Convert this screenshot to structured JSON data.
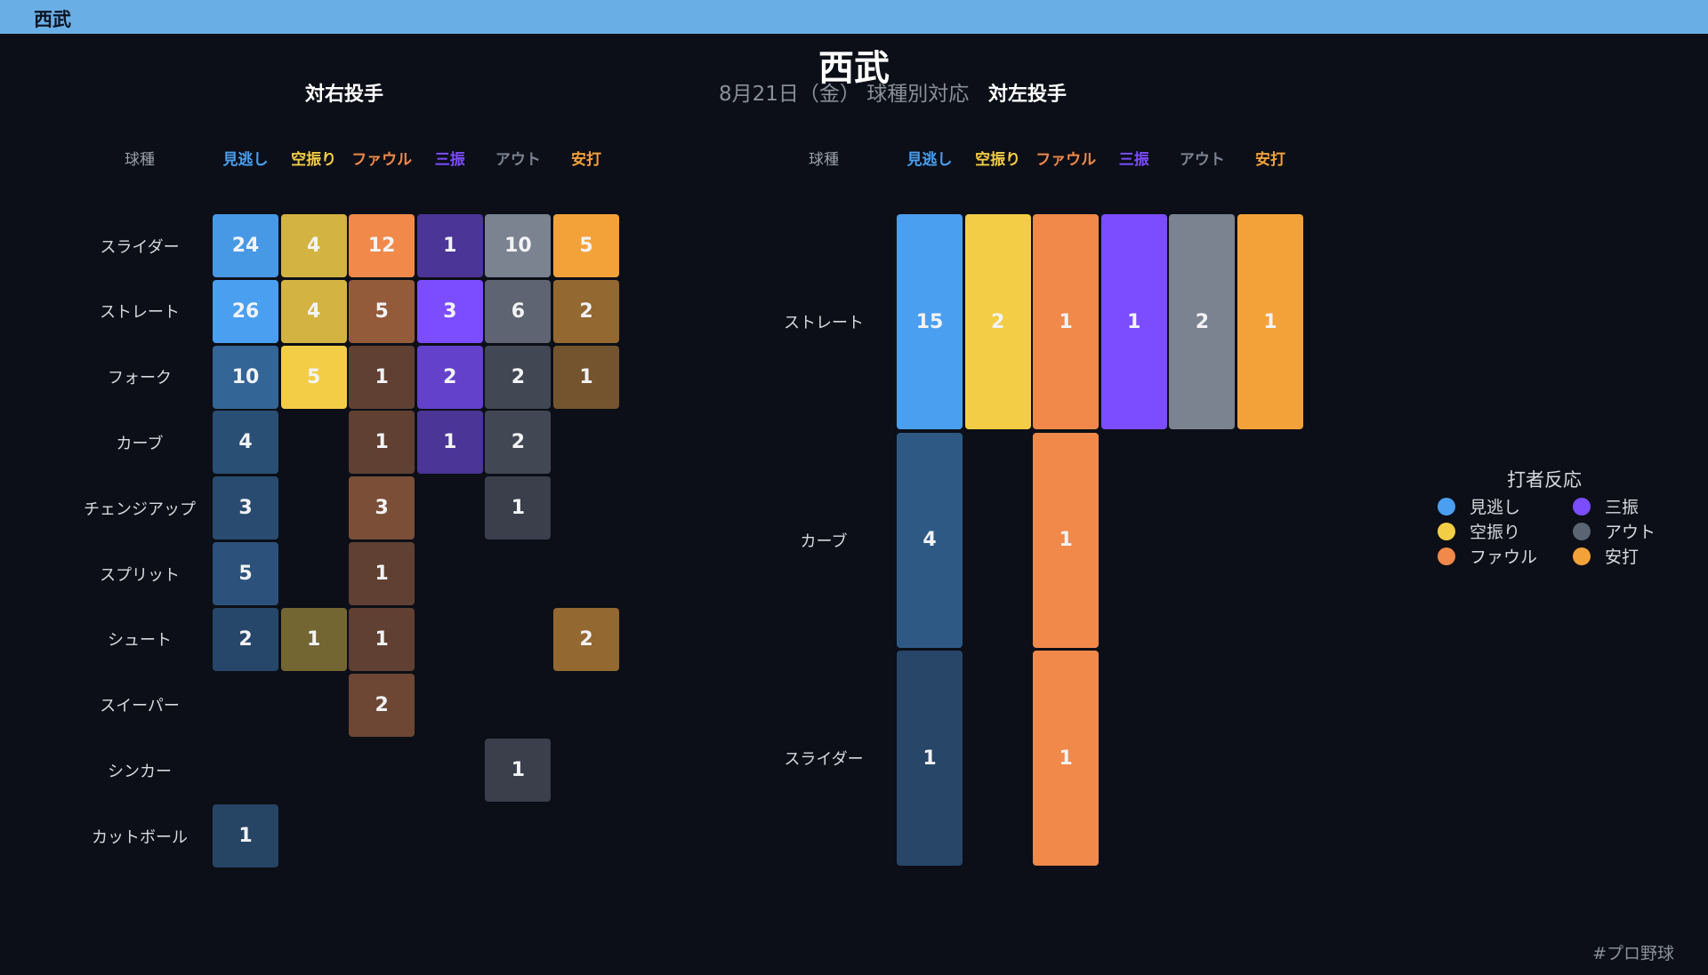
{
  "topbar": {
    "title": "西武"
  },
  "header": {
    "title": "西武",
    "subtitle": "8月21日（金） 球種別対応"
  },
  "legend": {
    "title": "打者反応",
    "items": [
      {
        "label": "見逃し",
        "color": "#4a9ff0"
      },
      {
        "label": "三振",
        "color": "#7c4dff"
      },
      {
        "label": "空振り",
        "color": "#f3cd45"
      },
      {
        "label": "アウト",
        "color": "#5a6473"
      },
      {
        "label": "ファウル",
        "color": "#f0894a"
      },
      {
        "label": "安打",
        "color": "#f3a23a"
      }
    ]
  },
  "footer": {
    "hashtag": "#プロ野球"
  },
  "chart_data": [
    {
      "type": "heatmap",
      "title": "対右投手",
      "row_header": "球種",
      "columns": [
        {
          "label": "見逃し",
          "color": "#4a9ff0"
        },
        {
          "label": "空振り",
          "color": "#f3cd45"
        },
        {
          "label": "ファウル",
          "color": "#f0894a"
        },
        {
          "label": "三振",
          "color": "#7c4dff"
        },
        {
          "label": "アウト",
          "color": "#7b8290"
        },
        {
          "label": "安打",
          "color": "#f3a23a"
        }
      ],
      "rows": [
        "スライダー",
        "ストレート",
        "フォーク",
        "カーブ",
        "チェンジアップ",
        "スプリット",
        "シュート",
        "スイーパー",
        "シンカー",
        "カットボール"
      ],
      "values": [
        [
          24,
          4,
          12,
          1,
          10,
          5
        ],
        [
          26,
          4,
          5,
          3,
          6,
          2
        ],
        [
          10,
          5,
          1,
          2,
          2,
          1
        ],
        [
          4,
          null,
          1,
          1,
          2,
          null
        ],
        [
          3,
          null,
          3,
          null,
          1,
          null
        ],
        [
          5,
          null,
          1,
          null,
          null,
          null
        ],
        [
          2,
          1,
          1,
          null,
          null,
          2
        ],
        [
          null,
          null,
          2,
          null,
          null,
          null
        ],
        [
          null,
          null,
          null,
          null,
          1,
          null
        ],
        [
          1,
          null,
          null,
          null,
          null,
          null
        ]
      ]
    },
    {
      "type": "heatmap",
      "title": "対左投手",
      "row_header": "球種",
      "columns": [
        {
          "label": "見逃し",
          "color": "#4a9ff0"
        },
        {
          "label": "空振り",
          "color": "#f3cd45"
        },
        {
          "label": "ファウル",
          "color": "#f0894a"
        },
        {
          "label": "三振",
          "color": "#7c4dff"
        },
        {
          "label": "アウト",
          "color": "#7b8290"
        },
        {
          "label": "安打",
          "color": "#f3a23a"
        }
      ],
      "rows": [
        "ストレート",
        "カーブ",
        "スライダー"
      ],
      "values": [
        [
          15,
          2,
          1,
          1,
          2,
          1
        ],
        [
          4,
          null,
          1,
          null,
          null,
          null
        ],
        [
          1,
          null,
          1,
          null,
          null,
          null
        ]
      ]
    }
  ]
}
